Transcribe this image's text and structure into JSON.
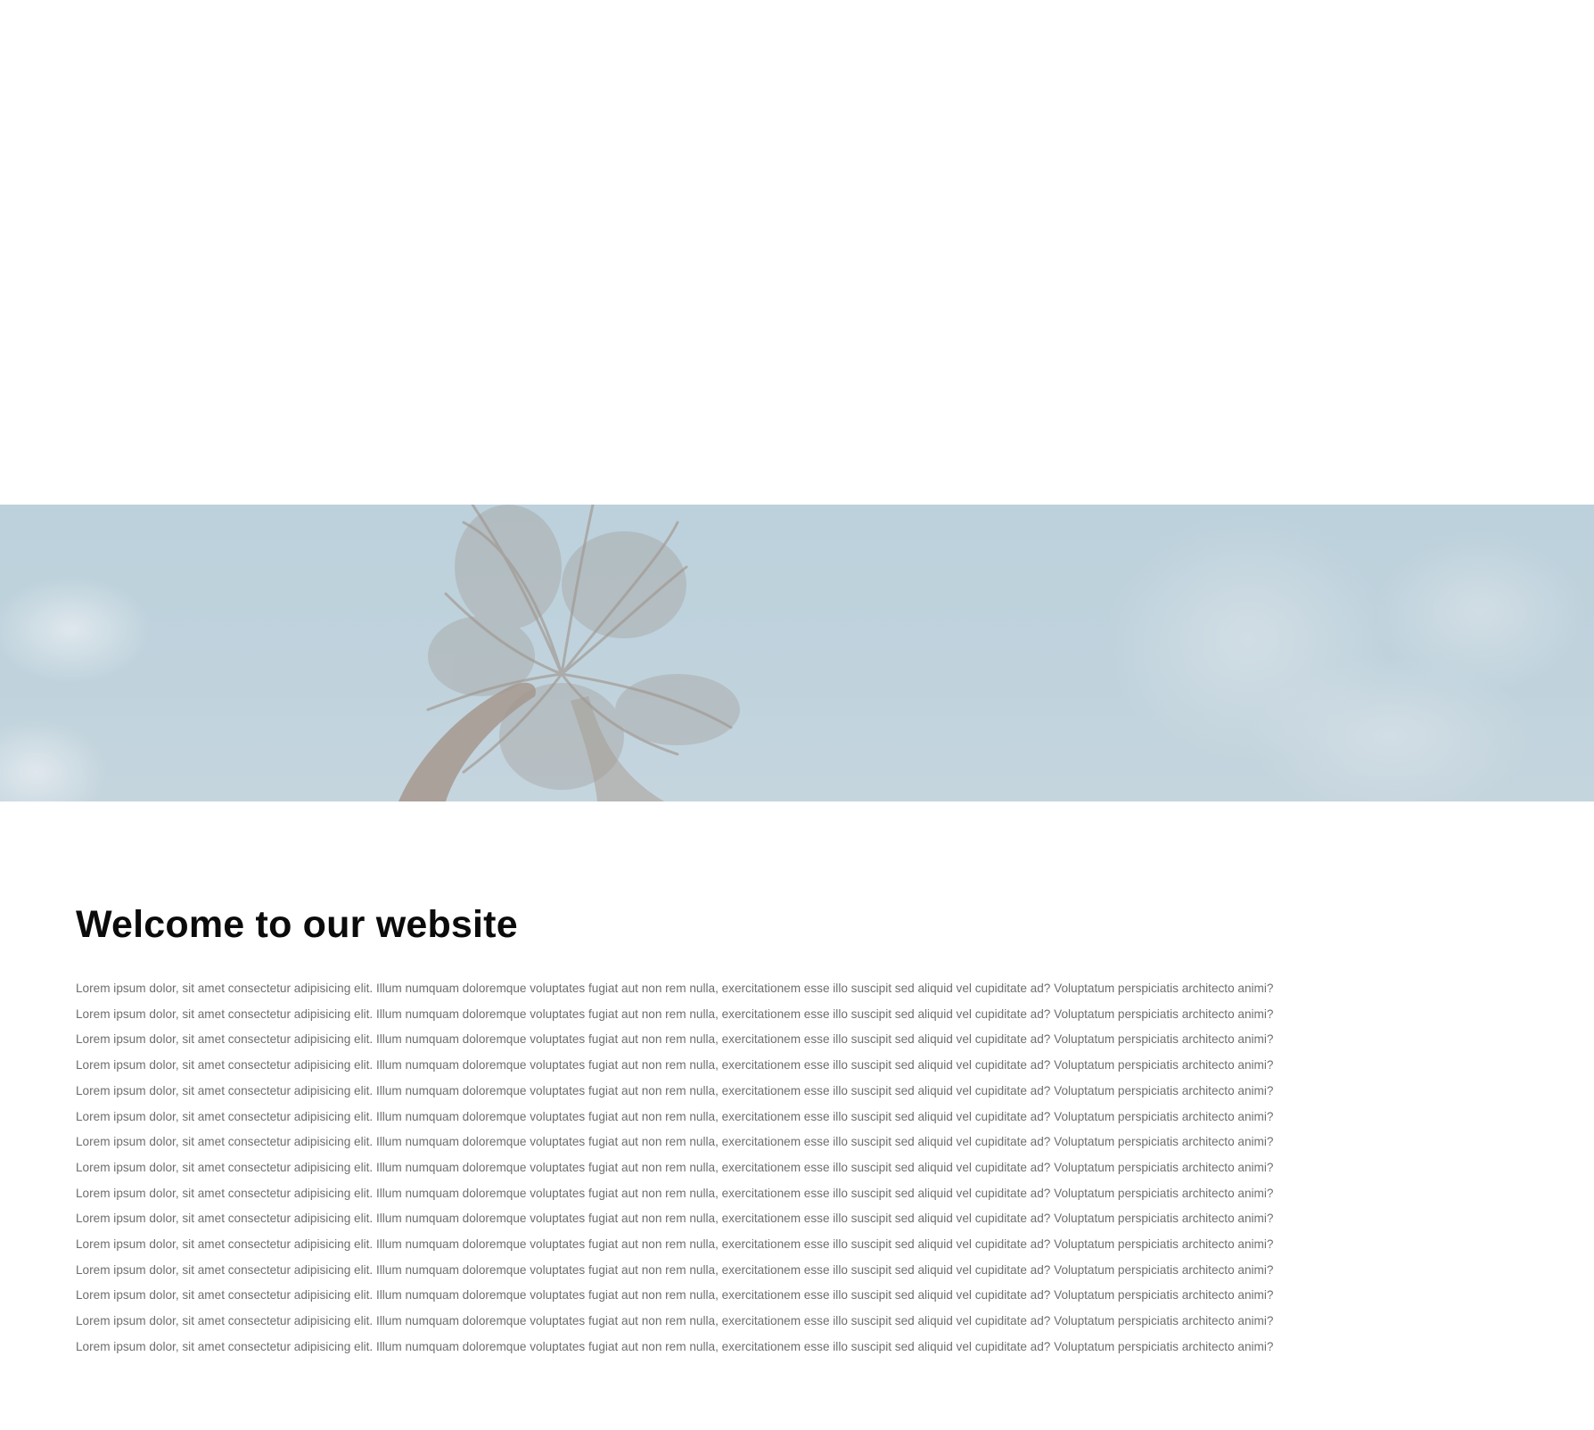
{
  "hero": {
    "image": "palm-tree-sky-photo",
    "colors": {
      "sky": "#bcd1dc",
      "palm": "#a59d95"
    }
  },
  "main": {
    "heading": "Welcome to our website",
    "paragraphs": [
      "Lorem ipsum dolor, sit amet consectetur adipisicing elit. Illum numquam doloremque voluptates fugiat aut non rem nulla, exercitationem esse illo suscipit sed aliquid vel cupiditate ad? Voluptatum perspiciatis architecto animi?",
      "Lorem ipsum dolor, sit amet consectetur adipisicing elit. Illum numquam doloremque voluptates fugiat aut non rem nulla, exercitationem esse illo suscipit sed aliquid vel cupiditate ad? Voluptatum perspiciatis architecto animi?",
      "Lorem ipsum dolor, sit amet consectetur adipisicing elit. Illum numquam doloremque voluptates fugiat aut non rem nulla, exercitationem esse illo suscipit sed aliquid vel cupiditate ad? Voluptatum perspiciatis architecto animi?",
      "Lorem ipsum dolor, sit amet consectetur adipisicing elit. Illum numquam doloremque voluptates fugiat aut non rem nulla, exercitationem esse illo suscipit sed aliquid vel cupiditate ad? Voluptatum perspiciatis architecto animi?",
      "Lorem ipsum dolor, sit amet consectetur adipisicing elit. Illum numquam doloremque voluptates fugiat aut non rem nulla, exercitationem esse illo suscipit sed aliquid vel cupiditate ad? Voluptatum perspiciatis architecto animi?",
      "Lorem ipsum dolor, sit amet consectetur adipisicing elit. Illum numquam doloremque voluptates fugiat aut non rem nulla, exercitationem esse illo suscipit sed aliquid vel cupiditate ad? Voluptatum perspiciatis architecto animi?",
      "Lorem ipsum dolor, sit amet consectetur adipisicing elit. Illum numquam doloremque voluptates fugiat aut non rem nulla, exercitationem esse illo suscipit sed aliquid vel cupiditate ad? Voluptatum perspiciatis architecto animi?",
      "Lorem ipsum dolor, sit amet consectetur adipisicing elit. Illum numquam doloremque voluptates fugiat aut non rem nulla, exercitationem esse illo suscipit sed aliquid vel cupiditate ad? Voluptatum perspiciatis architecto animi?",
      "Lorem ipsum dolor, sit amet consectetur adipisicing elit. Illum numquam doloremque voluptates fugiat aut non rem nulla, exercitationem esse illo suscipit sed aliquid vel cupiditate ad? Voluptatum perspiciatis architecto animi?",
      "Lorem ipsum dolor, sit amet consectetur adipisicing elit. Illum numquam doloremque voluptates fugiat aut non rem nulla, exercitationem esse illo suscipit sed aliquid vel cupiditate ad? Voluptatum perspiciatis architecto animi?",
      "Lorem ipsum dolor, sit amet consectetur adipisicing elit. Illum numquam doloremque voluptates fugiat aut non rem nulla, exercitationem esse illo suscipit sed aliquid vel cupiditate ad? Voluptatum perspiciatis architecto animi?",
      "Lorem ipsum dolor, sit amet consectetur adipisicing elit. Illum numquam doloremque voluptates fugiat aut non rem nulla, exercitationem esse illo suscipit sed aliquid vel cupiditate ad? Voluptatum perspiciatis architecto animi?",
      "Lorem ipsum dolor, sit amet consectetur adipisicing elit. Illum numquam doloremque voluptates fugiat aut non rem nulla, exercitationem esse illo suscipit sed aliquid vel cupiditate ad? Voluptatum perspiciatis architecto animi?",
      "Lorem ipsum dolor, sit amet consectetur adipisicing elit. Illum numquam doloremque voluptates fugiat aut non rem nulla, exercitationem esse illo suscipit sed aliquid vel cupiditate ad? Voluptatum perspiciatis architecto animi?",
      "Lorem ipsum dolor, sit amet consectetur adipisicing elit. Illum numquam doloremque voluptates fugiat aut non rem nulla, exercitationem esse illo suscipit sed aliquid vel cupiditate ad? Voluptatum perspiciatis architecto animi?"
    ]
  }
}
